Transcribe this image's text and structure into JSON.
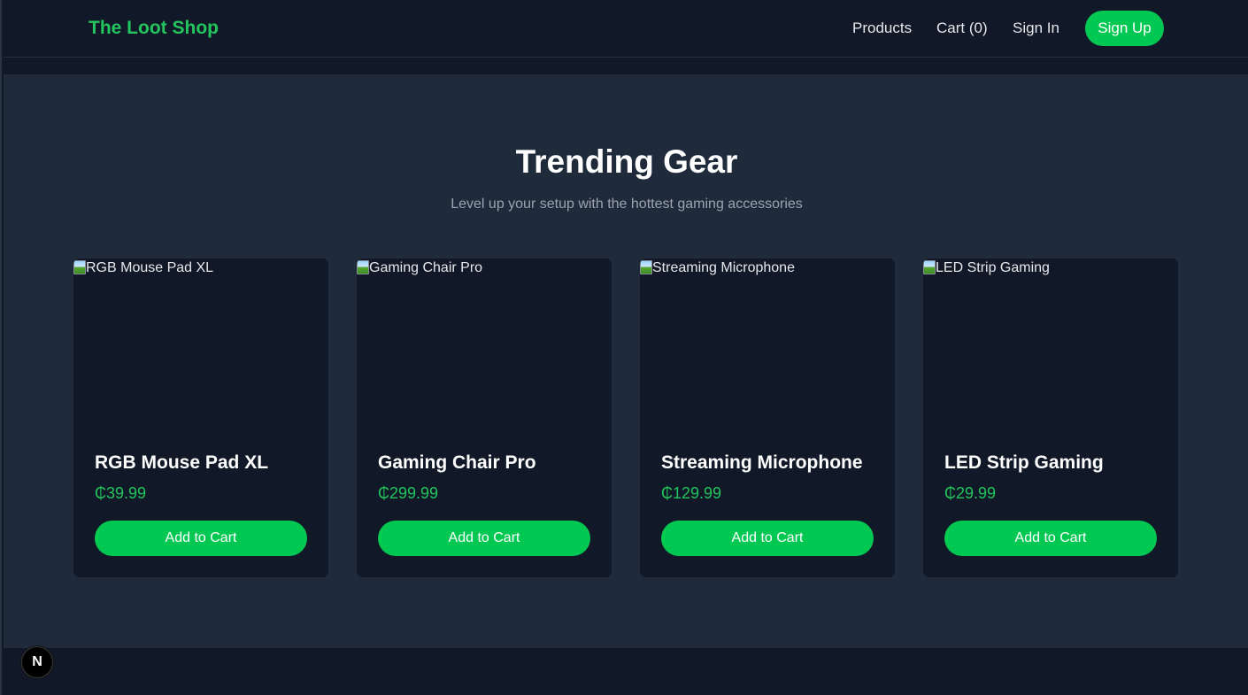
{
  "header": {
    "logo": "The Loot Shop",
    "nav": {
      "products": "Products",
      "cart": "Cart (0)",
      "signin": "Sign In",
      "signup": "Sign Up"
    }
  },
  "hero": {
    "title": "Trending Gear",
    "subtitle": "Level up your setup with the hottest gaming accessories"
  },
  "products": [
    {
      "image_alt": "RGB Mouse Pad XL",
      "name": "RGB Mouse Pad XL",
      "price": "₵39.99",
      "button": "Add to Cart"
    },
    {
      "image_alt": "Gaming Chair Pro",
      "name": "Gaming Chair Pro",
      "price": "₵299.99",
      "button": "Add to Cart"
    },
    {
      "image_alt": "Streaming Microphone",
      "name": "Streaming Microphone",
      "price": "₵129.99",
      "button": "Add to Cart"
    },
    {
      "image_alt": "LED Strip Gaming",
      "name": "LED Strip Gaming",
      "price": "₵29.99",
      "button": "Add to Cart"
    }
  ],
  "dev_badge": {
    "letter": "N",
    "icon": "nextjs-icon"
  },
  "colors": {
    "accent": "#00c853",
    "accent_text": "#22c55e",
    "background": "#111827",
    "hero_background": "#1f2a3b"
  }
}
